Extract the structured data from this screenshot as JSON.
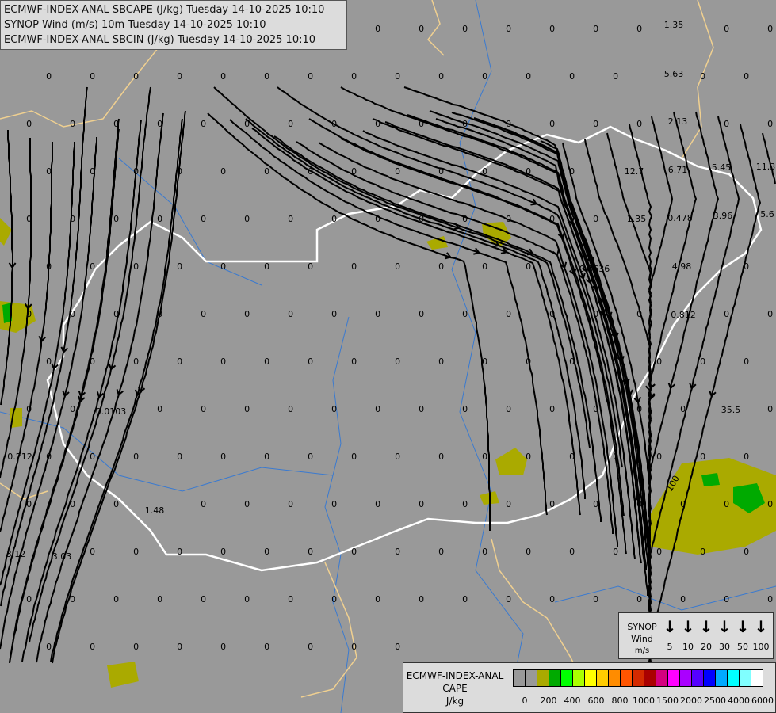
{
  "header": {
    "lines": [
      "ECMWF-INDEX-ANAL SBCAPE (J/kg) Tuesday 14-10-2025 10:10",
      "SYNOP Wind (m/s) 10m Tuesday 14-10-2025 10:10",
      "ECMWF-INDEX-ANAL SBCIN (J/kg) Tuesday 14-10-2025 10:10"
    ]
  },
  "wind_legend": {
    "title": "SYNOP",
    "subtitle": "Wind",
    "unit": "m/s",
    "speeds": [
      "5",
      "10",
      "20",
      "30",
      "50",
      "100"
    ]
  },
  "cape_legend": {
    "title": "ECMWF-INDEX-ANAL",
    "subtitle": "CAPE",
    "unit": "J/kg",
    "colors": [
      "#999999",
      "#999999",
      "#aaaa00",
      "#00aa00",
      "#00ff00",
      "#aaff00",
      "#ffff00",
      "#ffcc00",
      "#ff8c00",
      "#ff5500",
      "#d42a00",
      "#aa0000",
      "#d4007f",
      "#ff00ff",
      "#aa00ff",
      "#5500ff",
      "#0000ff",
      "#00aaff",
      "#00ffff",
      "#80ffff",
      "#ffffff"
    ],
    "ticks": [
      "0",
      "200",
      "400",
      "600",
      "800",
      "1000",
      "1500",
      "2000",
      "2500",
      "4000",
      "6000"
    ]
  },
  "map": {
    "colors": {
      "background": "#999999",
      "border": "#ffffff",
      "coast": "#f0d090",
      "river": "#3a7ad0",
      "cape_low": "#aaaa00",
      "cape_mid": "#00aa00",
      "streamline": "#000000"
    },
    "cin_labels": [
      "1.35",
      "5.63",
      "2.13",
      "6.71",
      "5.45",
      "11.3",
      "12.7",
      "1.35",
      "0.478",
      "3.96",
      "5.6",
      "4.98",
      "0.0636",
      "0.812",
      "35.5",
      "0.0103",
      "0.212",
      "1.48",
      "3.12",
      "3.03",
      "100",
      "0"
    ]
  }
}
